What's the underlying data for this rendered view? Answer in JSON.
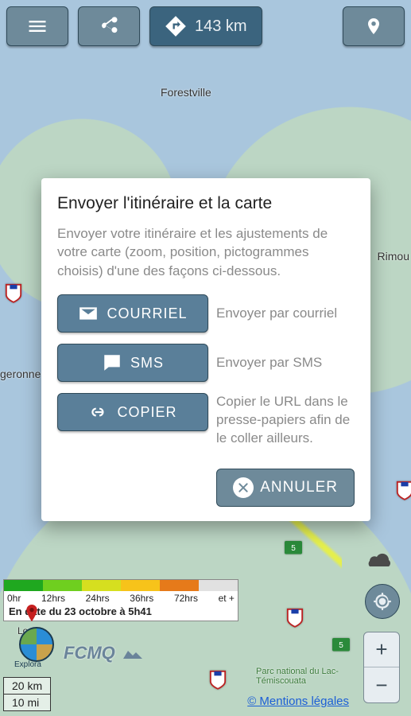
{
  "topbar": {
    "distance": "143 km"
  },
  "dialog": {
    "title": "Envoyer l'itinéraire et la carte",
    "lead": "Envoyer votre itinéraire et les ajustements de votre carte (zoom, position, pictogrammes choisis) d'une des façons ci-dessous.",
    "email_button": "COURRIEL",
    "email_desc": "Envoyer par courriel",
    "sms_button": "SMS",
    "sms_desc": "Envoyer par SMS",
    "copy_button": "COPIER",
    "copy_desc": "Copier le URL dans le presse-papiers afin de le coller ailleurs.",
    "cancel": "ANNULER"
  },
  "legend": {
    "ticks": [
      "0hr",
      "12hrs",
      "24hrs",
      "36hrs",
      "72hrs",
      "et +"
    ],
    "date": "En date du 23 octobre à 5h41",
    "colors": [
      "#1fa81f",
      "#6fcf1f",
      "#d6df1f",
      "#f7c31a",
      "#e67a1a",
      "#e1e1e1"
    ]
  },
  "map": {
    "cities": {
      "forestville": "Forestville",
      "rimouski": "Rimou",
      "geronne": "geronne",
      "loup": "Loup",
      "parc": "Parc national du Lac-Témiscouata"
    }
  },
  "scale": {
    "km": "20 km",
    "mi": "10 mi"
  },
  "logos": {
    "via": "Explora"
  },
  "legal": "© Mentions légales",
  "zoom": {
    "in": "+",
    "out": "−"
  }
}
